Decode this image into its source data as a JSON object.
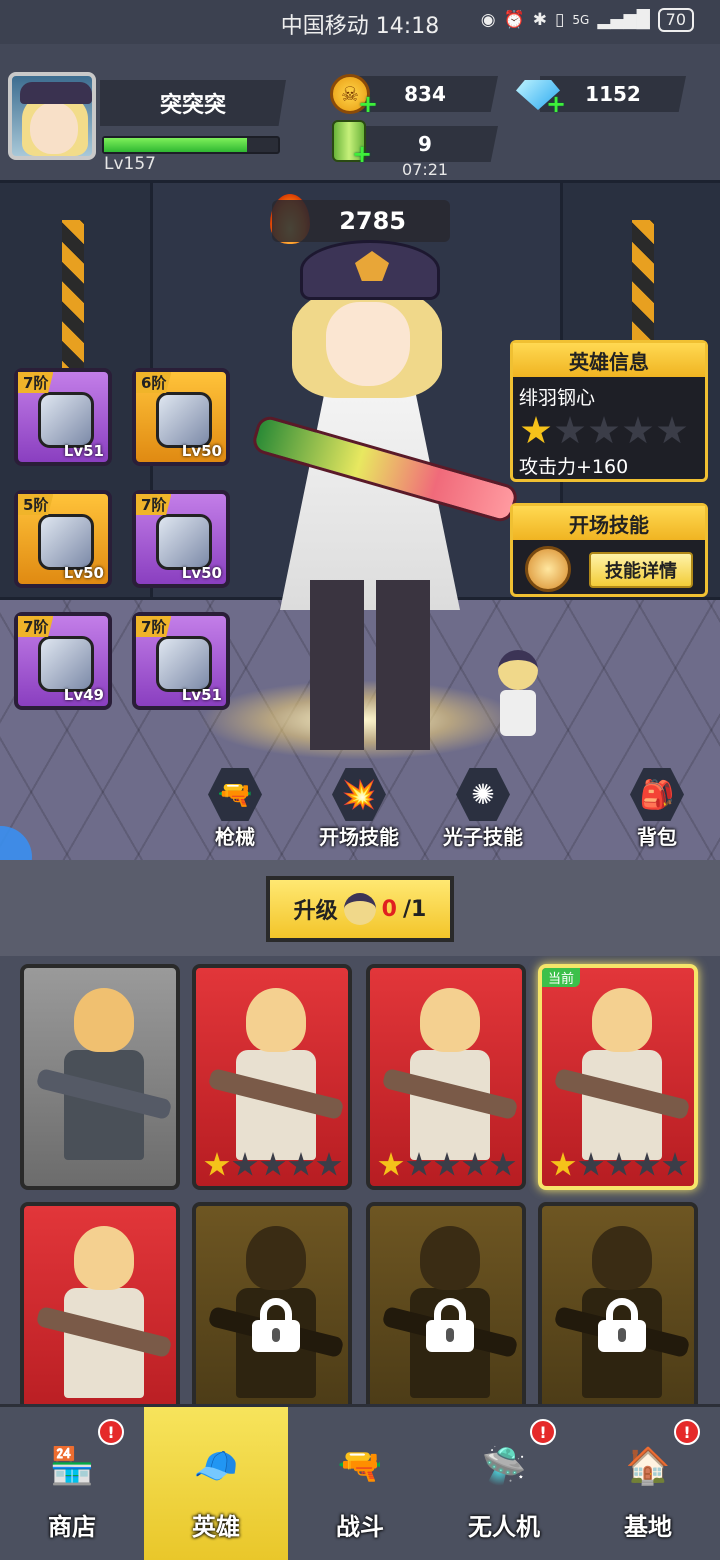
{
  "status": {
    "carrier_time": "中国移动 14:18",
    "network": "5G",
    "battery": "70"
  },
  "player": {
    "name": "突突突",
    "level": "Lv157",
    "xp_fraction": 0.82
  },
  "resources": {
    "coins": "834",
    "gems": "1152",
    "energy": "9",
    "energy_timer": "07:21"
  },
  "hero": {
    "power": "2785",
    "info_title": "英雄信息",
    "name": "绯羽钢心",
    "stars": 1,
    "max_stars": 5,
    "stat": "攻击力+160",
    "skill_title": "开场技能",
    "skill_button": "技能详情"
  },
  "equipment": [
    {
      "tier": "7阶",
      "level": "Lv51",
      "rarity": "purple",
      "icon": "helmet-icon"
    },
    {
      "tier": "6阶",
      "level": "Lv50",
      "rarity": "gold",
      "icon": "armor-vest-icon"
    },
    {
      "tier": "5阶",
      "level": "Lv50",
      "rarity": "gold",
      "icon": "boots-icon"
    },
    {
      "tier": "7阶",
      "level": "Lv50",
      "rarity": "purple",
      "icon": "gauntlet-icon"
    },
    {
      "tier": "7阶",
      "level": "Lv49",
      "rarity": "purple",
      "icon": "pants-icon"
    },
    {
      "tier": "7阶",
      "level": "Lv51",
      "rarity": "purple",
      "icon": "glove-icon"
    }
  ],
  "scene_buttons": [
    {
      "label": "枪械",
      "icon": "gun-icon"
    },
    {
      "label": "开场技能",
      "icon": "explosion-icon"
    },
    {
      "label": "光子技能",
      "icon": "photon-icon"
    },
    {
      "label": "背包",
      "icon": "backpack-icon"
    }
  ],
  "upgrade": {
    "label": "升级",
    "current": "0",
    "total": "/1"
  },
  "roster": [
    {
      "style": "grey",
      "stars": 0,
      "locked": false,
      "current": false
    },
    {
      "style": "red",
      "stars": 1,
      "locked": false,
      "current": false
    },
    {
      "style": "red",
      "stars": 1,
      "locked": false,
      "current": false
    },
    {
      "style": "red",
      "stars": 1,
      "locked": false,
      "current": true,
      "tag": "当前"
    },
    {
      "style": "red",
      "stars": 0,
      "locked": false,
      "current": false
    },
    {
      "style": "locked",
      "stars": 0,
      "locked": true,
      "current": false
    },
    {
      "style": "locked",
      "stars": 0,
      "locked": true,
      "current": false
    },
    {
      "style": "locked",
      "stars": 0,
      "locked": true,
      "current": false
    }
  ],
  "nav": [
    {
      "label": "商店",
      "icon": "shop-icon",
      "badge": "!",
      "active": false
    },
    {
      "label": "英雄",
      "icon": "hero-icon",
      "badge": "",
      "active": true
    },
    {
      "label": "战斗",
      "icon": "rifle-icon",
      "badge": "",
      "active": false
    },
    {
      "label": "无人机",
      "icon": "drone-icon",
      "badge": "!",
      "active": false
    },
    {
      "label": "基地",
      "icon": "base-dome-icon",
      "badge": "!",
      "active": false
    }
  ],
  "colors": {
    "accent_gold": "#f0c032",
    "xp_green": "#2fb832",
    "alert_red": "#e52a2a"
  }
}
